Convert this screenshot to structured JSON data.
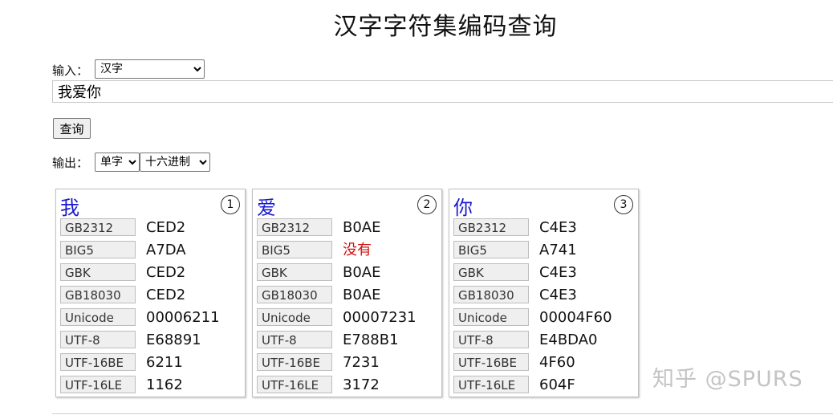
{
  "page": {
    "title": "汉字字符集编码查询"
  },
  "input_section": {
    "label": "输入：",
    "type_select": {
      "selected": "汉字"
    },
    "query_value": "我爱你",
    "query_button": "查询"
  },
  "output_section": {
    "label": "输出：",
    "mode_select": {
      "selected": "单字"
    },
    "base_select": {
      "selected": "十六进制"
    }
  },
  "cards": [
    {
      "char": "我",
      "index": "1",
      "rows": [
        {
          "label": "GB2312",
          "value": "CED2"
        },
        {
          "label": "BIG5",
          "value": "A7DA"
        },
        {
          "label": "GBK",
          "value": "CED2"
        },
        {
          "label": "GB18030",
          "value": "CED2"
        },
        {
          "label": "Unicode",
          "value": "00006211"
        },
        {
          "label": "UTF-8",
          "value": "E68891"
        },
        {
          "label": "UTF-16BE",
          "value": "6211"
        },
        {
          "label": "UTF-16LE",
          "value": "1162"
        }
      ]
    },
    {
      "char": "爱",
      "index": "2",
      "rows": [
        {
          "label": "GB2312",
          "value": "B0AE"
        },
        {
          "label": "BIG5",
          "value": "没有"
        },
        {
          "label": "GBK",
          "value": "B0AE"
        },
        {
          "label": "GB18030",
          "value": "B0AE"
        },
        {
          "label": "Unicode",
          "value": "00007231"
        },
        {
          "label": "UTF-8",
          "value": "E788B1"
        },
        {
          "label": "UTF-16BE",
          "value": "7231"
        },
        {
          "label": "UTF-16LE",
          "value": "3172"
        }
      ]
    },
    {
      "char": "你",
      "index": "3",
      "rows": [
        {
          "label": "GB2312",
          "value": "C4E3"
        },
        {
          "label": "BIG5",
          "value": "A741"
        },
        {
          "label": "GBK",
          "value": "C4E3"
        },
        {
          "label": "GB18030",
          "value": "C4E3"
        },
        {
          "label": "Unicode",
          "value": "00004F60"
        },
        {
          "label": "UTF-8",
          "value": "E4BDA0"
        },
        {
          "label": "UTF-16BE",
          "value": "4F60"
        },
        {
          "label": "UTF-16LE",
          "value": "604F"
        }
      ]
    }
  ],
  "watermark": "知乎 @SPURS",
  "colors": {
    "char": "#1a1acc",
    "missing": "#d01010"
  }
}
